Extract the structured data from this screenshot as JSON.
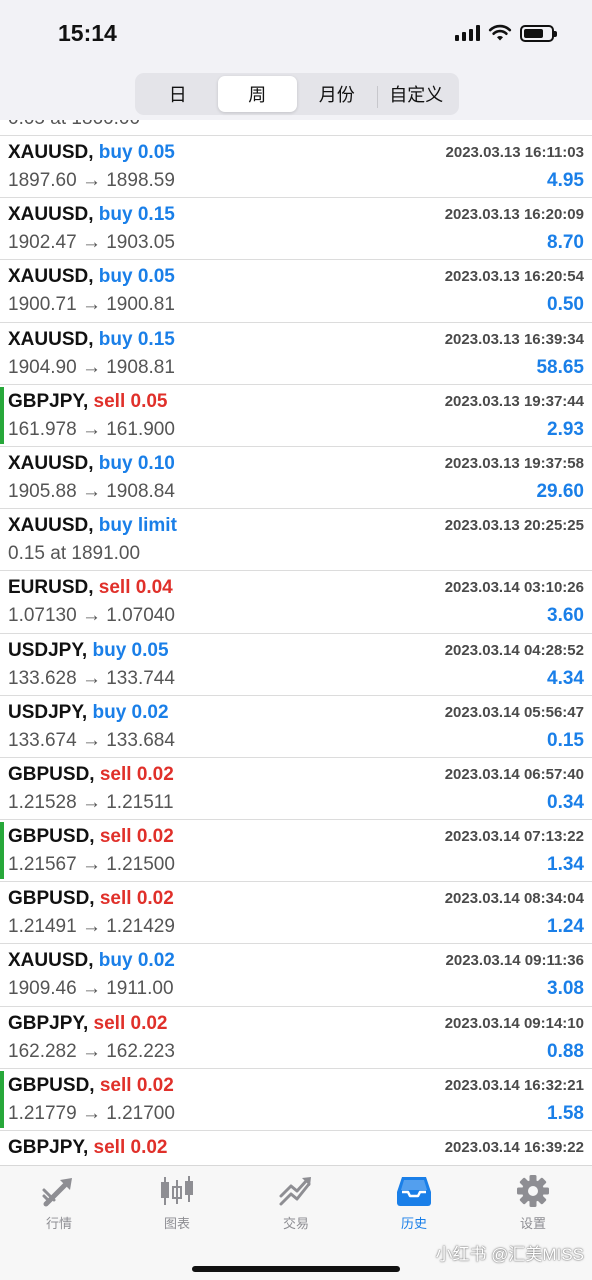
{
  "status": {
    "time": "15:14"
  },
  "segments": [
    {
      "label": "日"
    },
    {
      "label": "周"
    },
    {
      "label": "月份"
    },
    {
      "label": "自定义"
    }
  ],
  "partial_row_text": "0.05 at 1860.00",
  "trades": [
    {
      "symbol": "XAUUSD,",
      "side": "buy 0.05",
      "side_type": "buy",
      "date": "2023.03.13 16:11:03",
      "price": "1897.60 → 1898.59",
      "profit": "4.95",
      "bar": false
    },
    {
      "symbol": "XAUUSD,",
      "side": "buy 0.15",
      "side_type": "buy",
      "date": "2023.03.13 16:20:09",
      "price": "1902.47 → 1903.05",
      "profit": "8.70",
      "bar": false
    },
    {
      "symbol": "XAUUSD,",
      "side": "buy 0.05",
      "side_type": "buy",
      "date": "2023.03.13 16:20:54",
      "price": "1900.71 → 1900.81",
      "profit": "0.50",
      "bar": false
    },
    {
      "symbol": "XAUUSD,",
      "side": "buy 0.15",
      "side_type": "buy",
      "date": "2023.03.13 16:39:34",
      "price": "1904.90 → 1908.81",
      "profit": "58.65",
      "bar": false
    },
    {
      "symbol": "GBPJPY,",
      "side": "sell 0.05",
      "side_type": "sell",
      "date": "2023.03.13 19:37:44",
      "price": "161.978 → 161.900",
      "profit": "2.93",
      "bar": true
    },
    {
      "symbol": "XAUUSD,",
      "side": "buy 0.10",
      "side_type": "buy",
      "date": "2023.03.13 19:37:58",
      "price": "1905.88 → 1908.84",
      "profit": "29.60",
      "bar": false
    },
    {
      "symbol": "XAUUSD,",
      "side": "buy limit",
      "side_type": "buy",
      "date": "2023.03.13 20:25:25",
      "price": "0.15 at 1891.00",
      "profit": "",
      "bar": false
    },
    {
      "symbol": "EURUSD,",
      "side": "sell 0.04",
      "side_type": "sell",
      "date": "2023.03.14 03:10:26",
      "price": "1.07130 → 1.07040",
      "profit": "3.60",
      "bar": false
    },
    {
      "symbol": "USDJPY,",
      "side": "buy 0.05",
      "side_type": "buy",
      "date": "2023.03.14 04:28:52",
      "price": "133.628 → 133.744",
      "profit": "4.34",
      "bar": false
    },
    {
      "symbol": "USDJPY,",
      "side": "buy 0.02",
      "side_type": "buy",
      "date": "2023.03.14 05:56:47",
      "price": "133.674 → 133.684",
      "profit": "0.15",
      "bar": false
    },
    {
      "symbol": "GBPUSD,",
      "side": "sell 0.02",
      "side_type": "sell",
      "date": "2023.03.14 06:57:40",
      "price": "1.21528 → 1.21511",
      "profit": "0.34",
      "bar": false
    },
    {
      "symbol": "GBPUSD,",
      "side": "sell 0.02",
      "side_type": "sell",
      "date": "2023.03.14 07:13:22",
      "price": "1.21567 → 1.21500",
      "profit": "1.34",
      "bar": true
    },
    {
      "symbol": "GBPUSD,",
      "side": "sell 0.02",
      "side_type": "sell",
      "date": "2023.03.14 08:34:04",
      "price": "1.21491 → 1.21429",
      "profit": "1.24",
      "bar": false
    },
    {
      "symbol": "XAUUSD,",
      "side": "buy 0.02",
      "side_type": "buy",
      "date": "2023.03.14 09:11:36",
      "price": "1909.46 → 1911.00",
      "profit": "3.08",
      "bar": false
    },
    {
      "symbol": "GBPJPY,",
      "side": "sell 0.02",
      "side_type": "sell",
      "date": "2023.03.14 09:14:10",
      "price": "162.282 → 162.223",
      "profit": "0.88",
      "bar": false
    },
    {
      "symbol": "GBPUSD,",
      "side": "sell 0.02",
      "side_type": "sell",
      "date": "2023.03.14 16:32:21",
      "price": "1.21779 → 1.21700",
      "profit": "1.58",
      "bar": true
    },
    {
      "symbol": "GBPJPY,",
      "side": "sell 0.02",
      "side_type": "sell",
      "date": "2023.03.14 16:39:22",
      "price": "",
      "profit": "",
      "bar": false
    }
  ],
  "tabs": [
    {
      "label": "行情",
      "icon": "quotes-icon"
    },
    {
      "label": "图表",
      "icon": "chart-icon"
    },
    {
      "label": "交易",
      "icon": "trade-icon"
    },
    {
      "label": "历史",
      "icon": "history-icon"
    },
    {
      "label": "设置",
      "icon": "settings-icon"
    }
  ],
  "watermark": "小红书 @汇美MISS",
  "colors": {
    "buy": "#1a7fe8",
    "sell": "#e0302a",
    "bar": "#27a83a",
    "active_tab": "#1a7fe8",
    "inactive_tab": "#8e8e93"
  }
}
